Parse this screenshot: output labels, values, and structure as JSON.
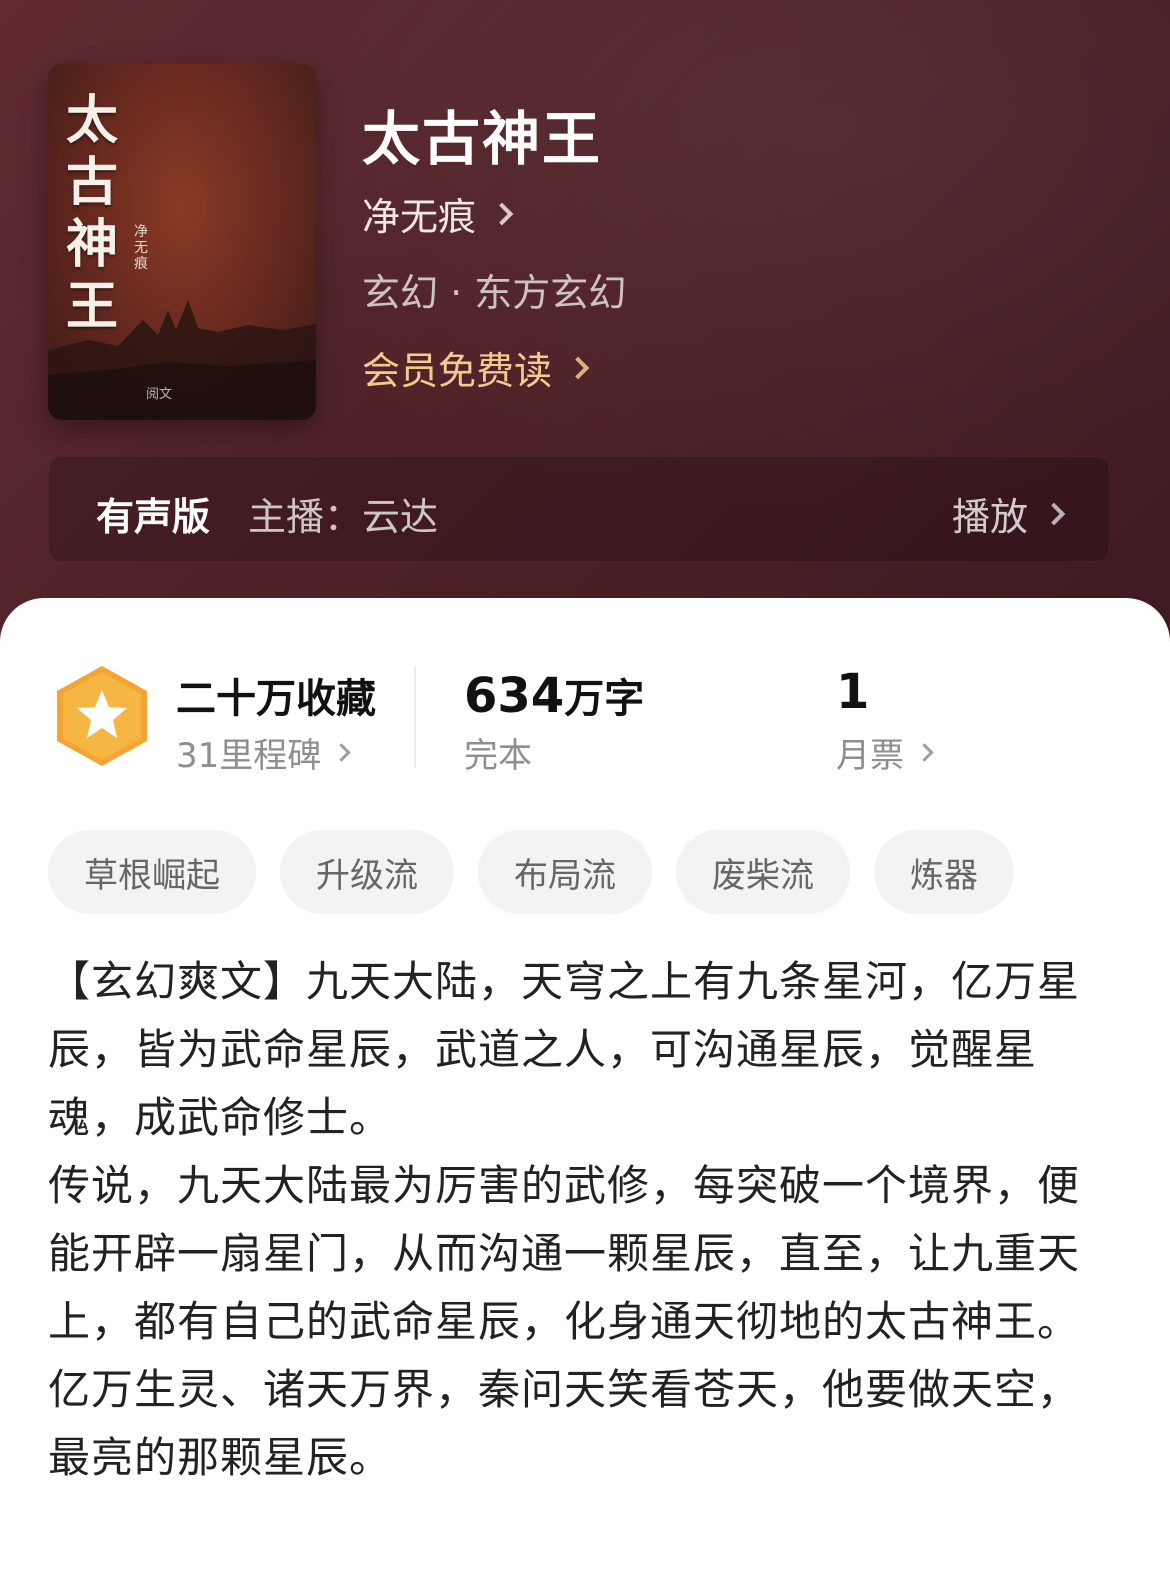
{
  "colors": {
    "hero_bg": "#4f2228",
    "vip_gold": "#f6c98f",
    "badge_orange": "#f3a533",
    "card_bg": "#ffffff"
  },
  "cover": {
    "title_vertical": "太古神王",
    "author_vertical": "净无痕",
    "publisher": "阅文"
  },
  "book": {
    "title": "太古神王",
    "author": "净无痕",
    "genre": "玄幻 · 东方玄幻",
    "vip_label": "会员免费读"
  },
  "audio": {
    "label": "有声版",
    "narrator": "主播：云达",
    "play_label": "播放"
  },
  "stats": {
    "favorites": "二十万收藏",
    "milestone": "31里程碑",
    "word_count_num": "634",
    "word_count_unit": "万字",
    "status": "完本",
    "monthly_ticket_count": "1",
    "monthly_ticket_label": "月票"
  },
  "tags": [
    "草根崛起",
    "升级流",
    "布局流",
    "废柴流",
    "炼器"
  ],
  "description": {
    "p1": "【玄幻爽文】九天大陆，天穹之上有九条星河，亿万星辰，皆为武命星辰，武道之人，可沟通星辰，觉醒星魂，成武命修士。",
    "p2": "传说，九天大陆最为厉害的武修，每突破一个境界，便能开辟一扇星门，从而沟通一颗星辰，直至，让九重天上，都有自己的武命星辰，化身通天彻地的太古神王。",
    "p3": "亿万生灵、诸天万界，秦问天笑看苍天，他要做天空，最亮的那颗星辰。"
  }
}
